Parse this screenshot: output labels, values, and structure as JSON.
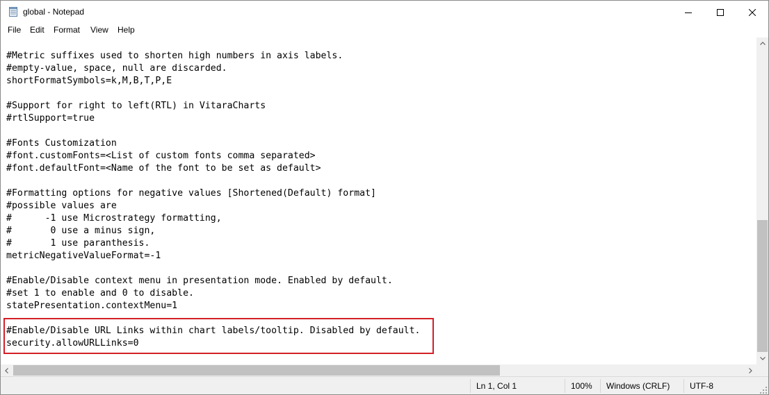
{
  "window": {
    "title": "global - Notepad",
    "minimize_icon": "minimize-icon",
    "maximize_icon": "maximize-icon",
    "close_icon": "close-icon"
  },
  "menu": [
    "File",
    "Edit",
    "Format",
    "View",
    "Help"
  ],
  "editor": {
    "lines": [
      "#Metric suffixes used to shorten high numbers in axis labels.",
      "#empty-value, space, null are discarded.",
      "shortFormatSymbols=k,M,B,T,P,E",
      "",
      "#Support for right to left(RTL) in VitaraCharts",
      "#rtlSupport=true",
      "",
      "#Fonts Customization",
      "#font.customFonts=<List of custom fonts comma separated>",
      "#font.defaultFont=<Name of the font to be set as default>",
      "",
      "#Formatting options for negative values [Shortened(Default) format]",
      "#possible values are",
      "#      -1 use Microstrategy formatting,",
      "#       0 use a minus sign,",
      "#       1 use paranthesis.",
      "metricNegativeValueFormat=-1",
      "",
      "#Enable/Disable context menu in presentation mode. Enabled by default.",
      "#set 1 to enable and 0 to disable.",
      "statePresentation.contextMenu=1",
      "",
      "#Enable/Disable URL Links within chart labels/tooltip. Disabled by default.",
      "security.allowURLLinks=0"
    ],
    "highlight_color": "#d21f26"
  },
  "status": {
    "position": "Ln 1, Col 1",
    "zoom": "100%",
    "line_ending": "Windows (CRLF)",
    "encoding": "UTF-8"
  }
}
